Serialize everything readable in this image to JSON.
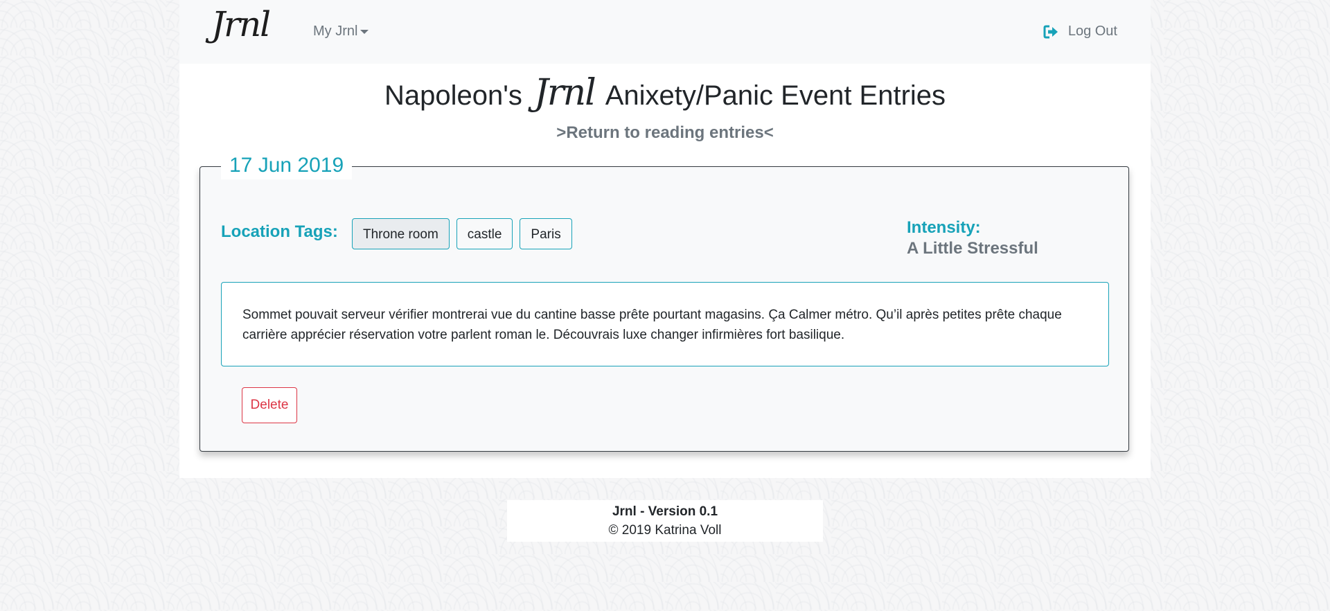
{
  "navbar": {
    "brand": "Jrnl",
    "dropdown_label": "My Jrnl",
    "logout_label": "Log Out"
  },
  "page": {
    "title_prefix": "Napoleon's",
    "title_brand": "Jrnl",
    "title_suffix": "Anixety/Panic Event Entries",
    "return_link": ">Return to reading entries<"
  },
  "entry": {
    "date": "17 Jun 2019",
    "location_label": "Location Tags:",
    "tags": [
      "Throne room",
      "castle",
      "Paris"
    ],
    "intensity_label": "Intensity:",
    "intensity_value": "A Little Stressful",
    "body": "Sommet pouvait serveur vérifier montrerai vue du cantine basse prête pourtant magasins. Ça Calmer métro. Qu’il après petites prête chaque carrière apprécier réservation votre parlent roman le. Découvrais luxe changer infirmières fort basilique.",
    "delete_label": "Delete"
  },
  "footer": {
    "version": "Jrnl - Version 0.1",
    "copyright": "© 2019 Katrina Voll"
  },
  "colors": {
    "accent": "#17a2b8",
    "danger": "#dc3545",
    "muted": "#6c757d"
  }
}
